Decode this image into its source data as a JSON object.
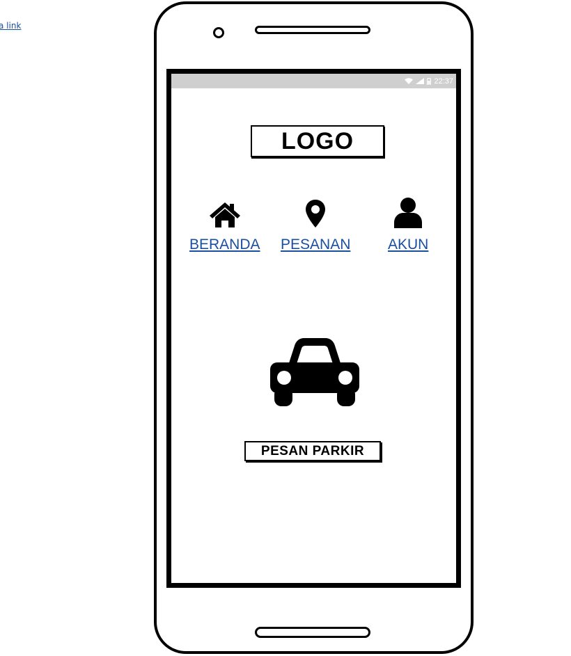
{
  "corner_link": {
    "label": "a link"
  },
  "status_bar": {
    "time": "22:37"
  },
  "logo": {
    "text": "LOGO"
  },
  "nav": {
    "items": [
      {
        "label": "BERANDA",
        "icon": "home-icon"
      },
      {
        "label": "PESANAN",
        "icon": "map-pin-icon"
      },
      {
        "label": "AKUN",
        "icon": "user-icon"
      }
    ]
  },
  "main": {
    "illustration": "car-icon",
    "button_label": "PESAN PARKIR"
  }
}
